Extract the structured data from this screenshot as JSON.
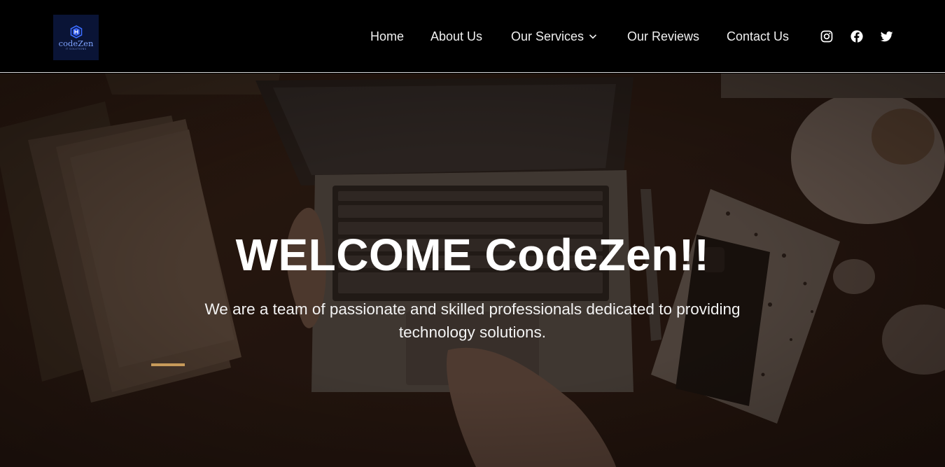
{
  "logo": {
    "icon": "hexagon-logo-icon",
    "name": "codeZen",
    "tagline": "IT SOLUTIONS",
    "color": "#7fa4ff"
  },
  "nav": {
    "items": [
      {
        "label": "Home"
      },
      {
        "label": "About Us"
      },
      {
        "label": "Our Services",
        "icon": "chevron-down-icon"
      },
      {
        "label": "Our Reviews"
      },
      {
        "label": "Contact Us"
      }
    ]
  },
  "social": [
    {
      "icon": "instagram-icon"
    },
    {
      "icon": "facebook-icon"
    },
    {
      "icon": "twitter-icon"
    }
  ],
  "hero": {
    "title": "WELCOME CodeZen!!",
    "subtitle": "We are a team of passionate and skilled professionals dedicated to providing technology solutions.",
    "accent_color": "#c79a5a"
  },
  "colors": {
    "header_bg": "#000000",
    "text": "#ffffff"
  }
}
